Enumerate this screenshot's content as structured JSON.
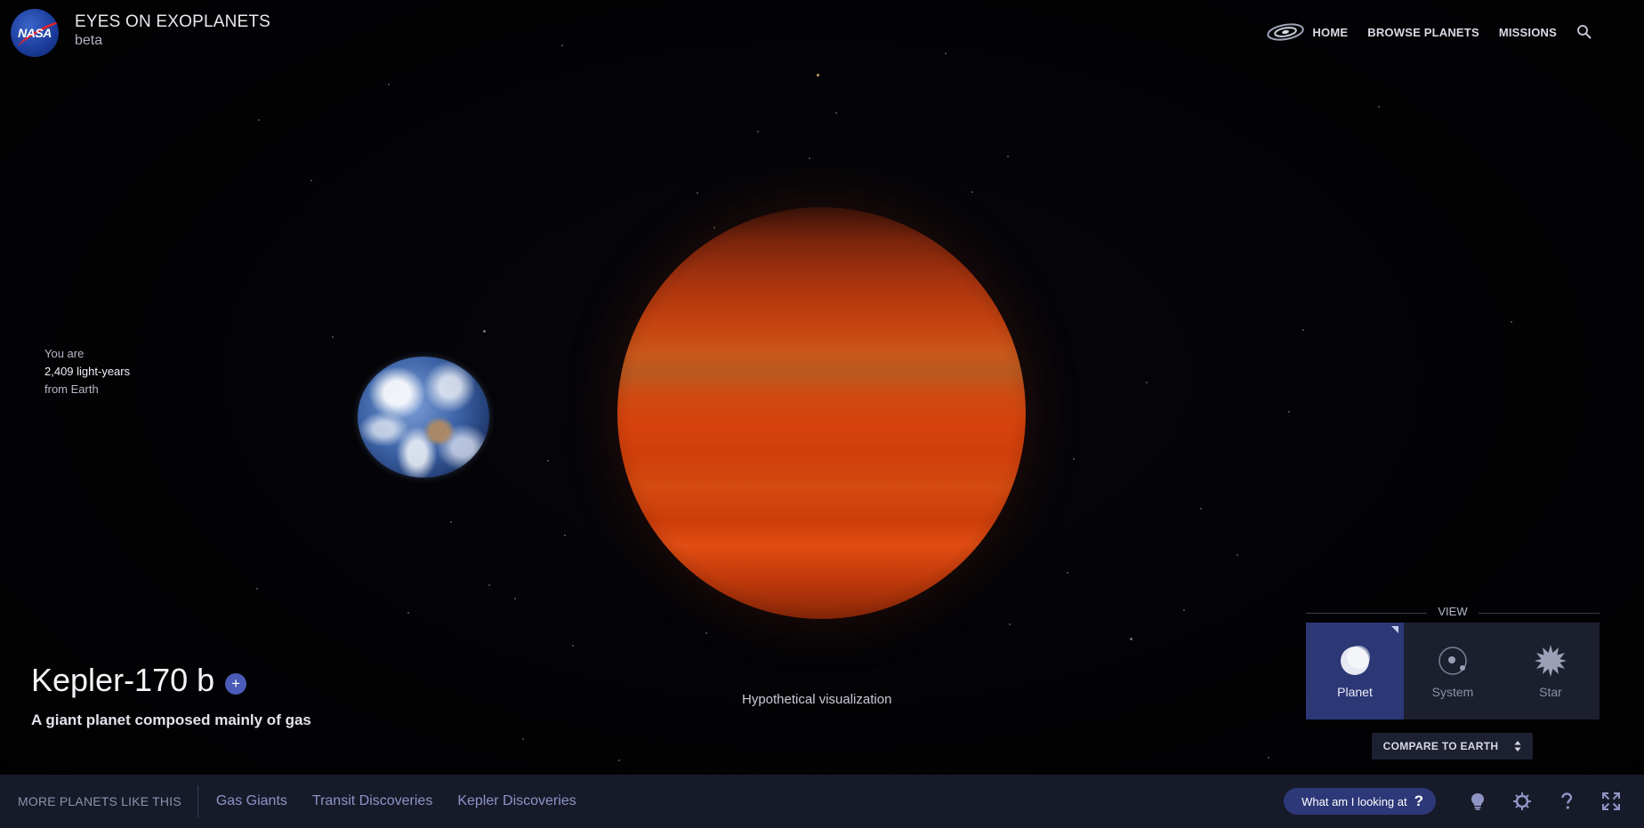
{
  "header": {
    "logo_text": "NASA",
    "title": "EYES ON EXOPLANETS",
    "subtitle": "beta",
    "nav": {
      "home": "HOME",
      "browse": "BROWSE PLANETS",
      "missions": "MISSIONS"
    },
    "icons": [
      "galaxy-icon",
      "search-icon"
    ]
  },
  "distance": {
    "prefix": "You are",
    "value": "2,409 light-years",
    "suffix": "from Earth"
  },
  "planet": {
    "name": "Kepler-170 b",
    "add_label": "+",
    "description": "A giant planet composed mainly of gas",
    "visualization_note": "Hypothetical visualization"
  },
  "view": {
    "label": "VIEW",
    "options": [
      {
        "label": "Planet",
        "icon": "planet-icon",
        "active": true
      },
      {
        "label": "System",
        "icon": "system-icon",
        "active": false
      },
      {
        "label": "Star",
        "icon": "star-icon",
        "active": false
      }
    ],
    "compare_label": "COMPARE TO EARTH"
  },
  "bottom_bar": {
    "more_label": "MORE PLANETS LIKE THIS",
    "categories": [
      "Gas Giants",
      "Transit Discoveries",
      "Kepler Discoveries"
    ],
    "help_button": "What am I looking at",
    "help_mark": "?",
    "tools": [
      "lightbulb-icon",
      "gear-icon",
      "help-icon",
      "fullscreen-icon"
    ]
  },
  "colors": {
    "accent": "#2c3876",
    "bar_background": "#171a29",
    "planet_orange": "#d6420c"
  }
}
